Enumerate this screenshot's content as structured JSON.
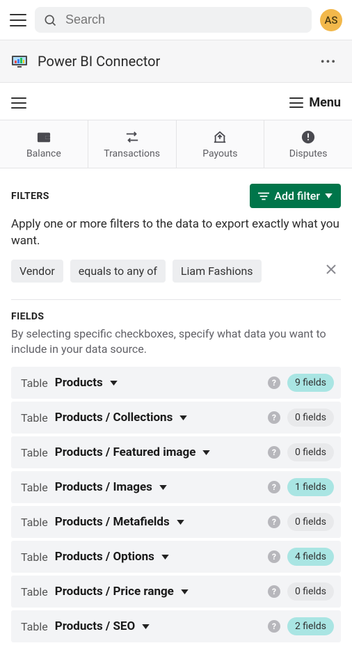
{
  "topbar": {
    "search_placeholder": "Search",
    "avatar_initials": "AS"
  },
  "app": {
    "title": "Power BI Connector"
  },
  "secnav": {
    "menu_label": "Menu"
  },
  "tabs": [
    {
      "label": "Balance"
    },
    {
      "label": "Transactions"
    },
    {
      "label": "Payouts"
    },
    {
      "label": "Disputes"
    }
  ],
  "filters": {
    "heading": "FILTERS",
    "add_label": "Add filter",
    "description": "Apply one or more filters to the data to export exactly what you want.",
    "chips": [
      "Vendor",
      "equals to any of",
      "Liam Fashions"
    ]
  },
  "fields": {
    "heading": "FIELDS",
    "description": "By selecting specific checkboxes, specify what data you want to include in your data source.",
    "table_prefix": "Table",
    "rows": [
      {
        "name": "Products",
        "count": 9,
        "active": true
      },
      {
        "name": "Products / Collections",
        "count": 0,
        "active": false
      },
      {
        "name": "Products / Featured image",
        "count": 0,
        "active": false
      },
      {
        "name": "Products / Images",
        "count": 1,
        "active": true
      },
      {
        "name": "Products / Metafields",
        "count": 0,
        "active": false
      },
      {
        "name": "Products / Options",
        "count": 4,
        "active": true
      },
      {
        "name": "Products / Price range",
        "count": 0,
        "active": false
      },
      {
        "name": "Products / SEO",
        "count": 2,
        "active": true
      }
    ]
  }
}
